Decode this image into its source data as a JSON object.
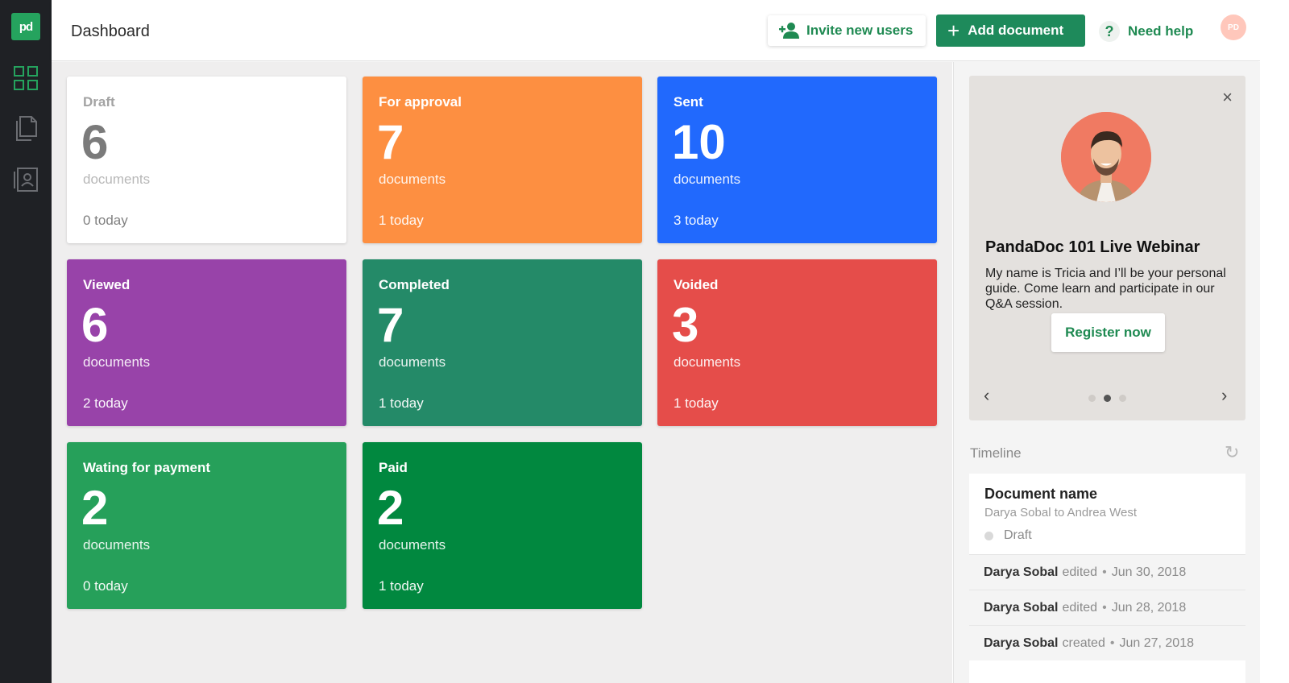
{
  "app": {
    "logo_text": "pd",
    "nav": [
      {
        "icon": "dashboard-grid-icon"
      },
      {
        "icon": "documents-icon"
      },
      {
        "icon": "contacts-icon"
      }
    ]
  },
  "header": {
    "title": "Dashboard",
    "invite_label": "Invite new users",
    "add_label": "Add document",
    "add_icon": "+",
    "help_label": "Need help",
    "help_icon": "?",
    "avatar_initials": "PD"
  },
  "cards": [
    {
      "title": "Draft",
      "count": "6",
      "unit": "documents",
      "today": "0 today",
      "color": "#ffffff"
    },
    {
      "title": "For approval",
      "count": "7",
      "unit": "documents",
      "today": "1 today",
      "color": "#fd8f41"
    },
    {
      "title": "Sent",
      "count": "10",
      "unit": "documents",
      "today": "3 today",
      "color": "#2169fd"
    },
    {
      "title": "Viewed",
      "count": "6",
      "unit": "documents",
      "today": "2 today",
      "color": "#9843a9"
    },
    {
      "title": "Completed",
      "count": "7",
      "unit": "documents",
      "today": "1 today",
      "color": "#248a68"
    },
    {
      "title": "Voided",
      "count": "3",
      "unit": "documents",
      "today": "1 today",
      "color": "#e54d4a"
    },
    {
      "title": "Wating for payment",
      "count": "2",
      "unit": "documents",
      "today": "0 today",
      "color": "#26a05a"
    },
    {
      "title": "Paid",
      "count": "2",
      "unit": "documents",
      "today": "1 today",
      "color": "#01883f"
    }
  ],
  "promo": {
    "title": "PandaDoc 101 Live Webinar",
    "text": "My name is Tricia and I’ll be your personal guide. Come learn and participate in our Q&A session.",
    "register_label": "Register now",
    "close_icon": "×",
    "prev_icon": "‹",
    "next_icon": "›",
    "active_slide": 2,
    "slide_count": 3
  },
  "timeline": {
    "label": "Timeline",
    "refresh_icon": "↻",
    "document": {
      "name": "Document name",
      "sub": "Darya Sobal to Andrea West",
      "status": "Draft"
    },
    "events": [
      {
        "who": "Darya Sobal",
        "action": "edited",
        "sep": "•",
        "date": "Jun 30, 2018"
      },
      {
        "who": "Darya Sobal",
        "action": "edited",
        "sep": "•",
        "date": "Jun 28, 2018"
      },
      {
        "who": "Darya Sobal",
        "action": "created",
        "sep": "•",
        "date": "Jun 27, 2018"
      }
    ]
  }
}
